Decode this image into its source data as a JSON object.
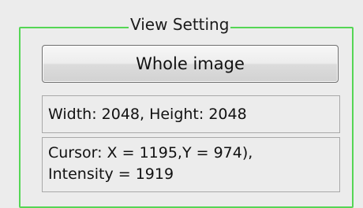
{
  "view_setting": {
    "title": "View Setting",
    "whole_image_button": "Whole image",
    "size_readout": "Width:  2048, Height: 2048",
    "cursor_line1": "Cursor: X = 1195,Y = 974),",
    "cursor_line2": "Intensity = 1919"
  },
  "colors": {
    "group_border": "#55d655",
    "background": "#ececec"
  }
}
